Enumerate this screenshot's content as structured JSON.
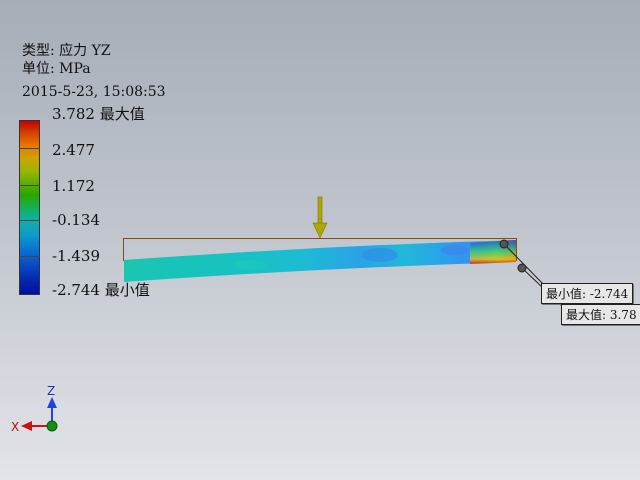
{
  "result_info": {
    "type_label": "类型: 应力 YZ",
    "unit_label": "单位: MPa",
    "timestamp": "2015-5-23, 15:08:53"
  },
  "legend": {
    "ticks": [
      {
        "value": "3.782",
        "suffix": "最大值"
      },
      {
        "value": "2.477",
        "suffix": ""
      },
      {
        "value": "1.172",
        "suffix": ""
      },
      {
        "value": "-0.134",
        "suffix": ""
      },
      {
        "value": "-1.439",
        "suffix": ""
      },
      {
        "value": "-2.744",
        "suffix": "最小值"
      }
    ]
  },
  "probes": {
    "min_label": "最小值: -2.744",
    "max_label": "最大值: 3.78"
  },
  "triad": {
    "z_label": "Z",
    "x_label": "X"
  },
  "colors": {
    "load_arrow": "#b0a800",
    "beam_outline": "#8a4a10",
    "max_color": "#d20000",
    "min_color": "#0010a0",
    "axis_x": "#d01010",
    "axis_z": "#2244dd",
    "origin": "#109010"
  }
}
